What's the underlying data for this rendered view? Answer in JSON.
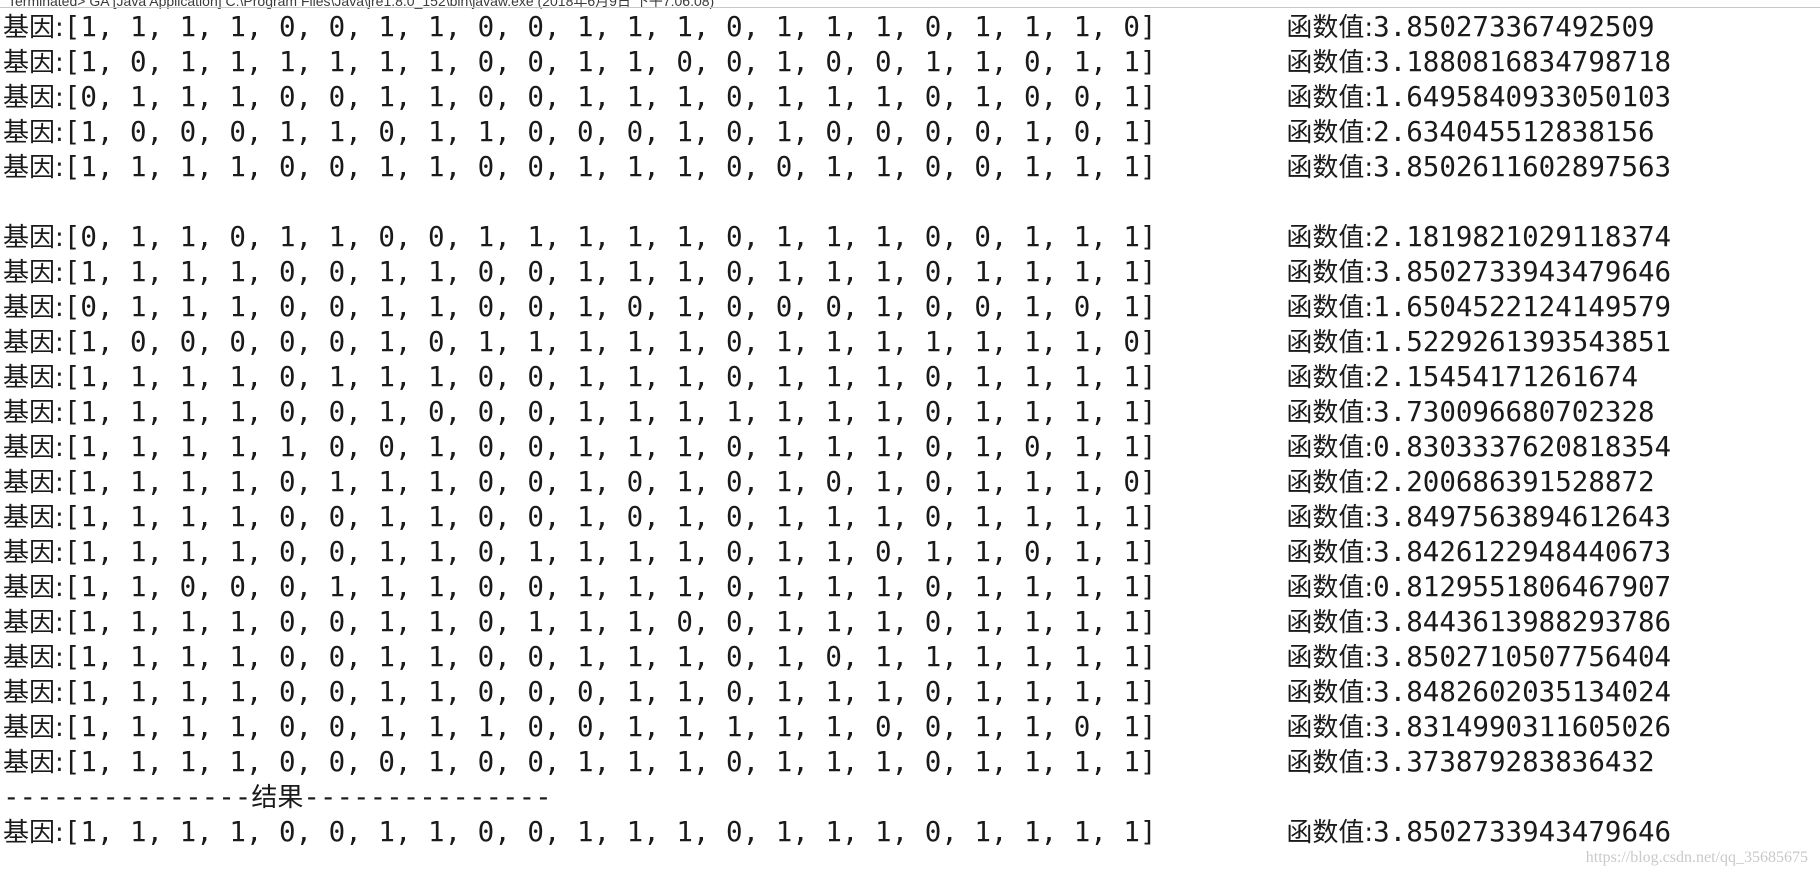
{
  "console": {
    "status": "Terminated> GA [Java Application] C:\\Program Files\\Java\\jre1.8.0_152\\bin\\javaw.exe (2018年6月9日 下午7:06:08)",
    "gene_label": "基因:",
    "value_label": "函数值:",
    "section_a": [
      {
        "gene": "[1, 1, 1, 1, 0, 0, 1, 1, 0, 0, 1, 1, 1, 0, 1, 1, 1, 0, 1, 1, 1, 0]",
        "value": "3.850273367492509"
      },
      {
        "gene": "[1, 0, 1, 1, 1, 1, 1, 1, 0, 0, 1, 1, 0, 0, 1, 0, 0, 1, 1, 0, 1, 1]",
        "value": "3.1880816834798718"
      },
      {
        "gene": "[0, 1, 1, 1, 0, 0, 1, 1, 0, 0, 1, 1, 1, 0, 1, 1, 1, 0, 1, 0, 0, 1]",
        "value": "1.6495840933050103"
      },
      {
        "gene": "[1, 0, 0, 0, 1, 1, 0, 1, 1, 0, 0, 0, 1, 0, 1, 0, 0, 0, 0, 1, 0, 1]",
        "value": "2.634045512838156"
      },
      {
        "gene": "[1, 1, 1, 1, 0, 0, 1, 1, 0, 0, 1, 1, 1, 0, 0, 1, 1, 0, 0, 1, 1, 1]",
        "value": "3.8502611602897563"
      }
    ],
    "section_b": [
      {
        "gene": "[0, 1, 1, 0, 1, 1, 0, 0, 1, 1, 1, 1, 1, 0, 1, 1, 1, 0, 0, 1, 1, 1]",
        "value": "2.1819821029118374"
      },
      {
        "gene": "[1, 1, 1, 1, 0, 0, 1, 1, 0, 0, 1, 1, 1, 0, 1, 1, 1, 0, 1, 1, 1, 1]",
        "value": "3.8502733943479646"
      },
      {
        "gene": "[0, 1, 1, 1, 0, 0, 1, 1, 0, 0, 1, 0, 1, 0, 0, 0, 1, 0, 0, 1, 0, 1]",
        "value": "1.6504522124149579"
      },
      {
        "gene": "[1, 0, 0, 0, 0, 0, 1, 0, 1, 1, 1, 1, 1, 0, 1, 1, 1, 1, 1, 1, 1, 0]",
        "value": "1.5229261393543851"
      },
      {
        "gene": "[1, 1, 1, 1, 0, 1, 1, 1, 0, 0, 1, 1, 1, 0, 1, 1, 1, 0, 1, 1, 1, 1]",
        "value": "2.15454171261674"
      },
      {
        "gene": "[1, 1, 1, 1, 0, 0, 1, 0, 0, 0, 1, 1, 1, 1, 1, 1, 1, 0, 1, 1, 1, 1]",
        "value": "3.730096680702328"
      },
      {
        "gene": "[1, 1, 1, 1, 1, 0, 0, 1, 0, 0, 1, 1, 1, 0, 1, 1, 1, 0, 1, 0, 1, 1]",
        "value": "0.8303337620818354"
      },
      {
        "gene": "[1, 1, 1, 1, 0, 1, 1, 1, 0, 0, 1, 0, 1, 0, 1, 0, 1, 0, 1, 1, 1, 0]",
        "value": "2.200686391528872"
      },
      {
        "gene": "[1, 1, 1, 1, 0, 0, 1, 1, 0, 0, 1, 0, 1, 0, 1, 1, 1, 0, 1, 1, 1, 1]",
        "value": "3.8497563894612643"
      },
      {
        "gene": "[1, 1, 1, 1, 0, 0, 1, 1, 0, 1, 1, 1, 1, 0, 1, 1, 0, 1, 1, 0, 1, 1]",
        "value": "3.8426122948440673"
      },
      {
        "gene": "[1, 1, 0, 0, 0, 1, 1, 1, 0, 0, 1, 1, 1, 0, 1, 1, 1, 0, 1, 1, 1, 1]",
        "value": "0.8129551806467907"
      },
      {
        "gene": "[1, 1, 1, 1, 0, 0, 1, 1, 0, 1, 1, 1, 0, 0, 1, 1, 1, 0, 1, 1, 1, 1]",
        "value": "3.8443613988293786"
      },
      {
        "gene": "[1, 1, 1, 1, 0, 0, 1, 1, 0, 0, 1, 1, 1, 0, 1, 0, 1, 1, 1, 1, 1, 1]",
        "value": "3.8502710507756404"
      },
      {
        "gene": "[1, 1, 1, 1, 0, 0, 1, 1, 0, 0, 0, 1, 1, 0, 1, 1, 1, 0, 1, 1, 1, 1]",
        "value": "3.8482602035134024"
      },
      {
        "gene": "[1, 1, 1, 1, 0, 0, 1, 1, 1, 0, 0, 1, 1, 1, 1, 1, 0, 0, 1, 1, 0, 1]",
        "value": "3.8314990311605026"
      },
      {
        "gene": "[1, 1, 1, 1, 0, 0, 0, 1, 0, 0, 1, 1, 1, 0, 1, 1, 1, 0, 1, 1, 1, 1]",
        "value": "3.373879283836432"
      }
    ],
    "separator": {
      "left": "---------------",
      "label": "结果",
      "right": "---------------"
    },
    "result": {
      "gene": "[1, 1, 1, 1, 0, 0, 1, 1, 0, 0, 1, 1, 1, 0, 1, 1, 1, 0, 1, 1, 1, 1]",
      "value": "3.8502733943479646"
    }
  },
  "watermark": "https://blog.csdn.net/qq_35685675"
}
